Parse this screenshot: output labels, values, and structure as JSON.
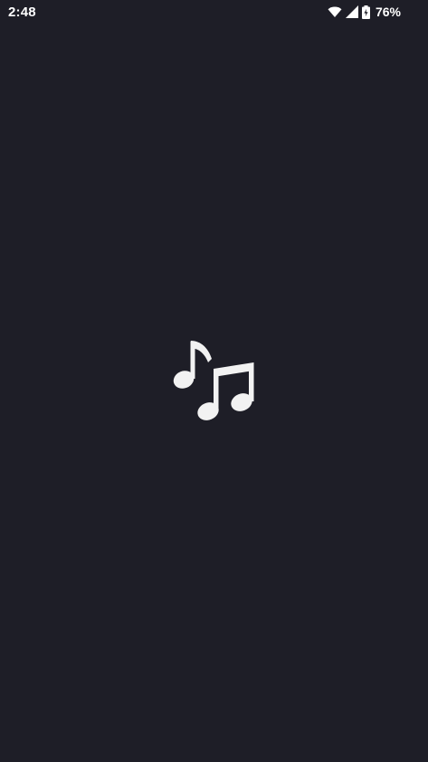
{
  "status_bar": {
    "time": "2:48",
    "battery_percent": "76%",
    "icons": [
      "wifi-icon",
      "cellular-signal-icon",
      "battery-charging-icon"
    ]
  },
  "splash": {
    "icon": "music-notes-icon"
  },
  "colors": {
    "background": "#1e1e27",
    "foreground": "#f2f2f2"
  }
}
